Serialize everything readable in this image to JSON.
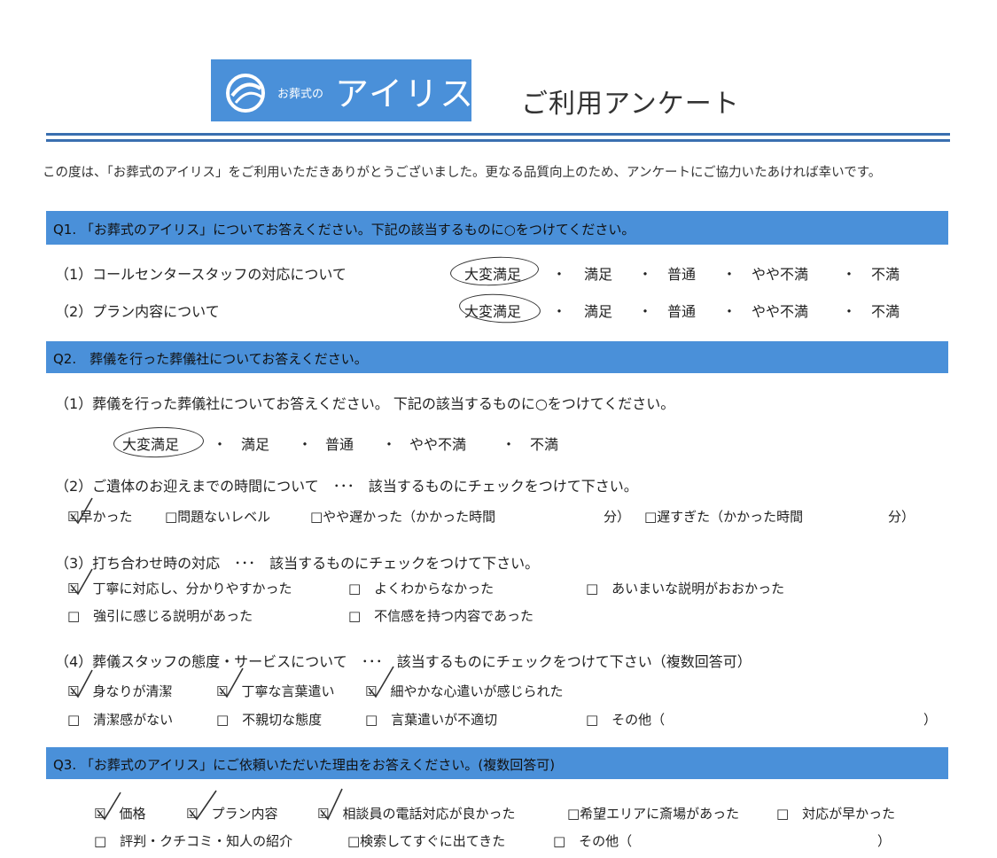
{
  "header": {
    "logo_small": "お葬式の",
    "logo_big": "アイリス",
    "title": "ご利用アンケート"
  },
  "intro": "この度は、「お葬式のアイリス」をご利用いただきありがとうございました。更なる品質向上のため、アンケートにご協力いたあければ幸いです。",
  "q1": {
    "heading": "Q1. 「お葬式のアイリス」についてお答えください。下記の該当するものに○をつけてください。",
    "items": [
      {
        "label": "（1）コールセンタースタッフの対応について"
      },
      {
        "label": "（2）プラン内容について"
      }
    ],
    "scale": [
      "大変満足",
      "・",
      "満足",
      "・",
      "普通",
      "・",
      "やや不満",
      "・",
      "不満"
    ]
  },
  "q2": {
    "heading": "Q2.　葬儀を行った葬儀社についてお答えください。",
    "p1": {
      "label": "（1）葬儀を行った葬儀社についてお答えください。 下記の該当するものに○をつけてください。",
      "scale": [
        "大変満足",
        "・",
        "満足",
        "・",
        "普通",
        "・",
        "やや不満",
        "・",
        "不満"
      ]
    },
    "p2": {
      "label": "（2）ご遺体のお迎えまでの時間について　･･･　該当するものにチェックをつけて下さい。",
      "opt1": "☑早かった",
      "opt2": "□問題ないレベル",
      "opt3": "□やや遅かった（かかった時間",
      "unit1": "分）",
      "opt4": "□遅すぎた（かかった時間",
      "unit2": "分）"
    },
    "p3": {
      "label": "（3）打ち合わせ時の対応　･･･　該当するものにチェックをつけて下さい。",
      "opts": [
        "☑　丁寧に対応し、分かりやすかった",
        "□　よくわからなかった",
        "□　あいまいな説明がおおかった",
        "□　強引に感じる説明があった",
        "□　不信感を持つ内容であった"
      ]
    },
    "p4": {
      "label": "（4）葬儀スタッフの態度・サービスについて　･･･　該当するものにチェックをつけて下さい（複数回答可）",
      "opts": [
        "☑　身なりが清潔",
        "☑　丁寧な言葉遣い",
        "☑　細やかな心遣いが感じられた",
        "□　清潔感がない",
        "□　不親切な態度",
        "□　言葉遣いが不適切",
        "□　その他（",
        "）"
      ]
    }
  },
  "q3": {
    "heading": "Q3. 「お葬式のアイリス」にご依頼いただいた理由をお答えください。(複数回答可)",
    "opts": [
      "☑　価格",
      "☑　プラン内容",
      "☑　相談員の電話対応が良かった",
      "□希望エリアに斎場があった",
      "□　対応が早かった",
      "□　評判・クチコミ・知人の紹介",
      "□検索してすぐに出てきた",
      "□　その他（",
      "）"
    ]
  }
}
